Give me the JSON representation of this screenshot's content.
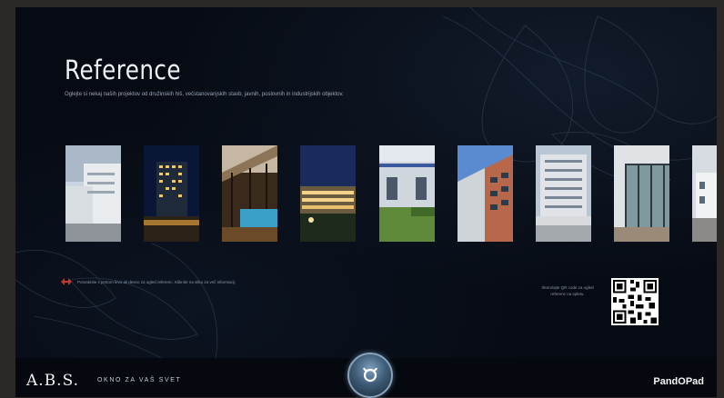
{
  "page": {
    "title": "Reference",
    "subtitle": "Oglejte si nekaj naših projektov od družinskih hiš, večstanovanjskih stavb, javnih, poslovnih in industrijskih objektov."
  },
  "gallery": {
    "items": [
      {
        "name": "reference-photo-1",
        "theme": "white-building"
      },
      {
        "name": "reference-photo-2",
        "theme": "night-tower"
      },
      {
        "name": "reference-photo-3",
        "theme": "pool-hall"
      },
      {
        "name": "reference-photo-4",
        "theme": "hotel-night"
      },
      {
        "name": "reference-photo-5",
        "theme": "lawn-building"
      },
      {
        "name": "reference-photo-6",
        "theme": "red-facade"
      },
      {
        "name": "reference-photo-7",
        "theme": "apartment-block"
      },
      {
        "name": "reference-photo-8",
        "theme": "glass-facade"
      },
      {
        "name": "reference-photo-9",
        "theme": "partial"
      }
    ]
  },
  "hint": {
    "text": "Pomaknite s prstom levo ali desno za ogled referenc. Kliknite na sliko za več informacij.",
    "icon": "swipe-arrows-icon",
    "accent": "#c0392b"
  },
  "qr": {
    "text": "Skenirajte QR code za ogled referenc na spletu."
  },
  "footer": {
    "logo": "A.B.S.",
    "slogan": "OKNO ZA VAŠ SVET",
    "brand": "PandOPad"
  },
  "home_button": {
    "icon": "home-logo-icon"
  }
}
